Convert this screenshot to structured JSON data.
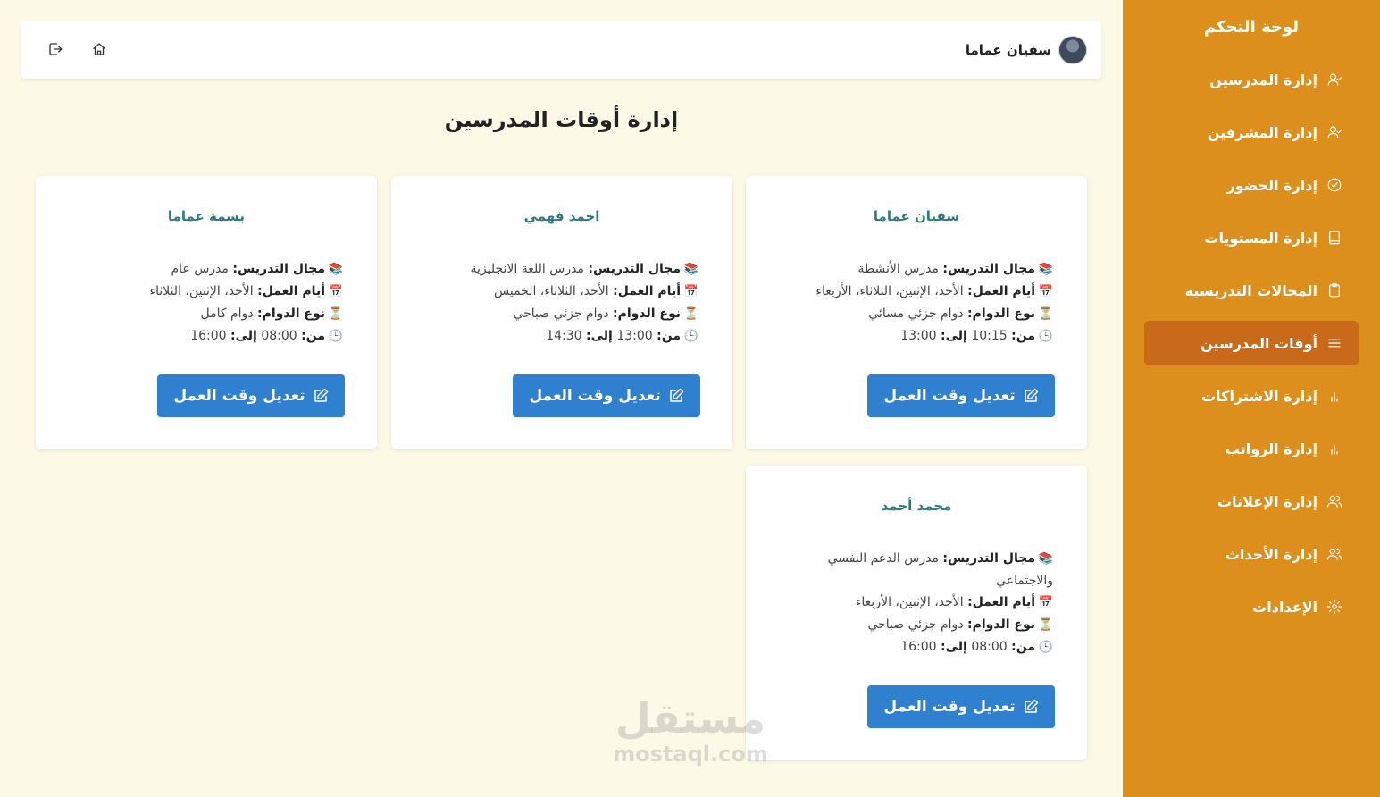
{
  "sidebar": {
    "title": "لوحة التحكم",
    "items": [
      {
        "label": "إدارة المدرسين",
        "icon": "user-check-icon"
      },
      {
        "label": "إدارة المشرفين",
        "icon": "user-check-icon"
      },
      {
        "label": "إدارة الحضور",
        "icon": "check-circle-icon"
      },
      {
        "label": "إدارة المستويات",
        "icon": "book-icon"
      },
      {
        "label": "المجالات التدريسية",
        "icon": "clipboard-icon"
      },
      {
        "label": "أوقات المدرسين",
        "icon": "menu-icon",
        "active": true
      },
      {
        "label": "إدارة الاشتراكات",
        "icon": "bar-chart-icon"
      },
      {
        "label": "إدارة الرواتب",
        "icon": "bar-chart-icon"
      },
      {
        "label": "إدارة الإعلانات",
        "icon": "users-icon"
      },
      {
        "label": "إدارة الأحداث",
        "icon": "users-icon"
      },
      {
        "label": "الإعدادات",
        "icon": "gear-icon"
      }
    ]
  },
  "header": {
    "user_name": "سفيان عماما"
  },
  "page": {
    "title": "إدارة أوقات المدرسين"
  },
  "labels": {
    "field": "مجال التدريس:",
    "days": "أيام العمل:",
    "type": "نوع الدوام:",
    "from": "من:",
    "to": "إلى:",
    "edit_button": "تعديل وقت العمل"
  },
  "cards": [
    {
      "name": "سفيان عماما",
      "field": "مدرس الأنشطة",
      "days": "الأحد، الإثنين، الثلاثاء، الأربعاء",
      "type": "دوام جزئي مسائي",
      "from": "10:15",
      "to": "13:00"
    },
    {
      "name": "احمد فهمي",
      "field": "مدرس اللغة الانجليزية",
      "days": "الأحد، الثلاثاء، الخميس",
      "type": "دوام جزئي صباحي",
      "from": "13:00",
      "to": "14:30"
    },
    {
      "name": "بسمة عماما",
      "field": "مدرس عام",
      "days": "الأحد، الإثنين، الثلاثاء",
      "type": "دوام كامل",
      "from": "08:00",
      "to": "16:00"
    },
    {
      "name": "محمد أحمد",
      "field": "مدرس الدعم النفسي والاجتماعي",
      "days": "الأحد، الإثنين، الأربعاء",
      "type": "دوام جزئي صباحي",
      "from": "08:00",
      "to": "16:00"
    }
  ],
  "watermark": {
    "ar": "مستقل",
    "en": "mostaql.com"
  },
  "colors": {
    "sidebar": "#dd8f1e",
    "active": "#c9691a",
    "button": "#2f80cf",
    "name": "#2c7a7b",
    "background": "#fdf9e7"
  }
}
